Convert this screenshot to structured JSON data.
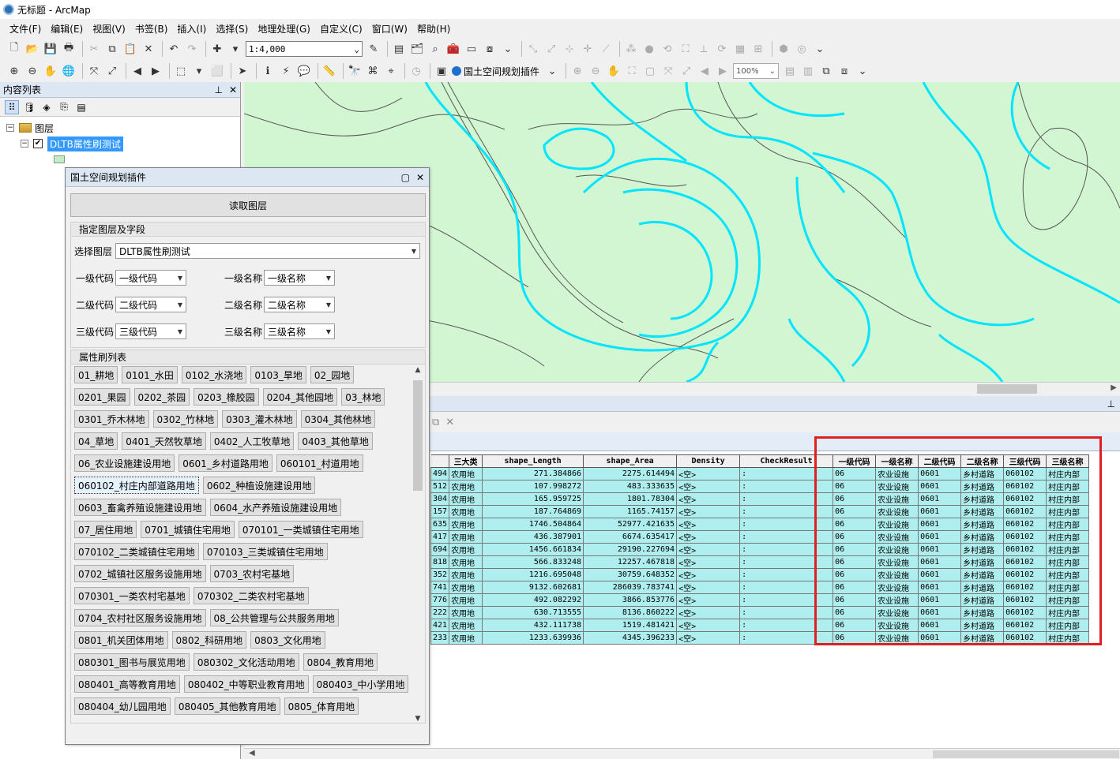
{
  "window": {
    "title": "无标题 - ArcMap"
  },
  "menu": [
    "文件(F)",
    "编辑(E)",
    "视图(V)",
    "书签(B)",
    "插入(I)",
    "选择(S)",
    "地理处理(G)",
    "自定义(C)",
    "窗口(W)",
    "帮助(H)"
  ],
  "toolbar": {
    "scale": "1:4,000",
    "zoom": "100%",
    "plugin_label": "国土空间规划插件"
  },
  "toc": {
    "title": "内容列表",
    "root_label": "图层",
    "layer_name": "DLTB属性刷测试"
  },
  "plugin": {
    "title": "国土空间规划插件",
    "read_button": "读取图层",
    "section1_title": "指定图层及字段",
    "select_layer_label": "选择图层",
    "select_layer_value": "DLTB属性刷测试",
    "fields": [
      {
        "label": "一级代码",
        "value": "一级代码",
        "label2": "一级名称",
        "value2": "一级名称"
      },
      {
        "label": "二级代码",
        "value": "二级代码",
        "label2": "二级名称",
        "value2": "二级名称"
      },
      {
        "label": "三级代码",
        "value": "三级代码",
        "label2": "三级名称",
        "value2": "三级名称"
      }
    ],
    "section2_title": "属性刷列表",
    "brush_rows": [
      [
        "01_耕地",
        "0101_水田",
        "0102_水浇地",
        "0103_旱地",
        "02_园地"
      ],
      [
        "0201_果园",
        "0202_茶园",
        "0203_橡胶园",
        "0204_其他园地",
        "03_林地"
      ],
      [
        "0301_乔木林地",
        "0302_竹林地",
        "0303_灌木林地",
        "0304_其他林地"
      ],
      [
        "04_草地",
        "0401_天然牧草地",
        "0402_人工牧草地",
        "0403_其他草地"
      ],
      [
        "06_农业设施建设用地",
        "0601_乡村道路用地",
        "060101_村道用地"
      ],
      [
        "060102_村庄内部道路用地",
        "0602_种植设施建设用地"
      ],
      [
        "0603_畜禽养殖设施建设用地",
        "0604_水产养殖设施建设用地"
      ],
      [
        "07_居住用地",
        "0701_城镇住宅用地",
        "070101_一类城镇住宅用地"
      ],
      [
        "070102_二类城镇住宅用地",
        "070103_三类城镇住宅用地"
      ],
      [
        "0702_城镇社区服务设施用地",
        "0703_农村宅基地"
      ],
      [
        "070301_一类农村宅基地",
        "070302_二类农村宅基地"
      ],
      [
        "0704_农村社区服务设施用地",
        "08_公共管理与公共服务用地"
      ],
      [
        "0801_机关团体用地",
        "0802_科研用地",
        "0803_文化用地"
      ],
      [
        "080301_图书与展览用地",
        "080302_文化活动用地",
        "0804_教育用地"
      ],
      [
        "080401_高等教育用地",
        "080402_中等职业教育用地",
        "080403_中小学用地"
      ],
      [
        "080404_幼儿园用地",
        "080405_其他教育用地",
        "0805_体育用地"
      ]
    ]
  },
  "table": {
    "headers": [
      "三大类",
      "shape_Length",
      "shape_Area",
      "Density",
      "CheckResult",
      "一级代码",
      "一级名称",
      "二级代码",
      "二级名称",
      "三级代码",
      "三级名称"
    ],
    "rows": [
      [
        "494",
        "农用地",
        "271.384866",
        "2275.614494",
        "<空>",
        ":",
        "06",
        "农业设施",
        "0601",
        "乡村道路",
        "060102",
        "村庄内部"
      ],
      [
        "512",
        "农用地",
        "107.998272",
        "483.333635",
        "<空>",
        ":",
        "06",
        "农业设施",
        "0601",
        "乡村道路",
        "060102",
        "村庄内部"
      ],
      [
        "304",
        "农用地",
        "165.959725",
        "1801.78304",
        "<空>",
        ":",
        "06",
        "农业设施",
        "0601",
        "乡村道路",
        "060102",
        "村庄内部"
      ],
      [
        "157",
        "农用地",
        "187.764869",
        "1165.74157",
        "<空>",
        ":",
        "06",
        "农业设施",
        "0601",
        "乡村道路",
        "060102",
        "村庄内部"
      ],
      [
        "635",
        "农用地",
        "1746.504864",
        "52977.421635",
        "<空>",
        ":",
        "06",
        "农业设施",
        "0601",
        "乡村道路",
        "060102",
        "村庄内部"
      ],
      [
        "417",
        "农用地",
        "436.387901",
        "6674.635417",
        "<空>",
        ":",
        "06",
        "农业设施",
        "0601",
        "乡村道路",
        "060102",
        "村庄内部"
      ],
      [
        "694",
        "农用地",
        "1456.661834",
        "29190.227694",
        "<空>",
        ":",
        "06",
        "农业设施",
        "0601",
        "乡村道路",
        "060102",
        "村庄内部"
      ],
      [
        "818",
        "农用地",
        "566.833248",
        "12257.467818",
        "<空>",
        ":",
        "06",
        "农业设施",
        "0601",
        "乡村道路",
        "060102",
        "村庄内部"
      ],
      [
        "352",
        "农用地",
        "1216.695048",
        "30759.648352",
        "<空>",
        ":",
        "06",
        "农业设施",
        "0601",
        "乡村道路",
        "060102",
        "村庄内部"
      ],
      [
        "741",
        "农用地",
        "9132.602681",
        "286039.783741",
        "<空>",
        ":",
        "06",
        "农业设施",
        "0601",
        "乡村道路",
        "060102",
        "村庄内部"
      ],
      [
        "776",
        "农用地",
        "492.082292",
        "3866.853776",
        "<空>",
        ":",
        "06",
        "农业设施",
        "0601",
        "乡村道路",
        "060102",
        "村庄内部"
      ],
      [
        "222",
        "农用地",
        "630.713555",
        "8136.860222",
        "<空>",
        ":",
        "06",
        "农业设施",
        "0601",
        "乡村道路",
        "060102",
        "村庄内部"
      ],
      [
        "421",
        "农用地",
        "432.111738",
        "1519.481421",
        "<空>",
        ":",
        "06",
        "农业设施",
        "0601",
        "乡村道路",
        "060102",
        "村庄内部"
      ],
      [
        "233",
        "农用地",
        "1233.639936",
        "4345.396233",
        "<空>",
        ":",
        "06",
        "农业设施",
        "0601",
        "乡村道路",
        "060102",
        "村庄内部"
      ]
    ]
  },
  "colors": {
    "map_fill": "#d2f5d2",
    "selection_outline": "#00e5ff",
    "table_row": "#aeeeee",
    "highlight_box": "#e02020"
  }
}
